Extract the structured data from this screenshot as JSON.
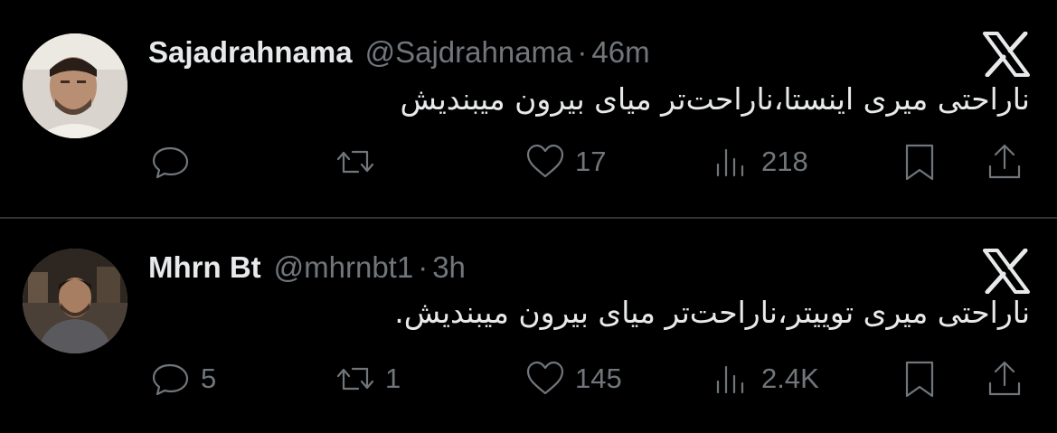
{
  "tweets": [
    {
      "author_name": "Sajadrahnama",
      "handle": "@Sajdrahnama",
      "separator": "·",
      "time": "46m",
      "text": "ناراحتی میری اینستا،ناراحت‌تر میای بیرون میبندیش",
      "avatar": "profile-photo",
      "stats": {
        "replies": "",
        "reposts": "",
        "likes": "17",
        "views": "218"
      }
    },
    {
      "author_name": "Mhrn Bt",
      "handle": "@mhrnbt1",
      "separator": "·",
      "time": "3h",
      "text": "ناراحتی میری توییتر،ناراحت‌تر میای بیرون میبندیش.",
      "avatar": "profile-photo",
      "stats": {
        "replies": "5",
        "reposts": "1",
        "likes": "145",
        "views": "2.4K"
      }
    }
  ],
  "icons": [
    "x-logo-icon",
    "reply-icon",
    "repost-icon",
    "like-icon",
    "views-icon",
    "bookmark-icon",
    "share-icon"
  ],
  "colors": {
    "background": "#000000",
    "text": "#e7e9ea",
    "secondary": "#71767b",
    "divider": "#2f3336"
  }
}
